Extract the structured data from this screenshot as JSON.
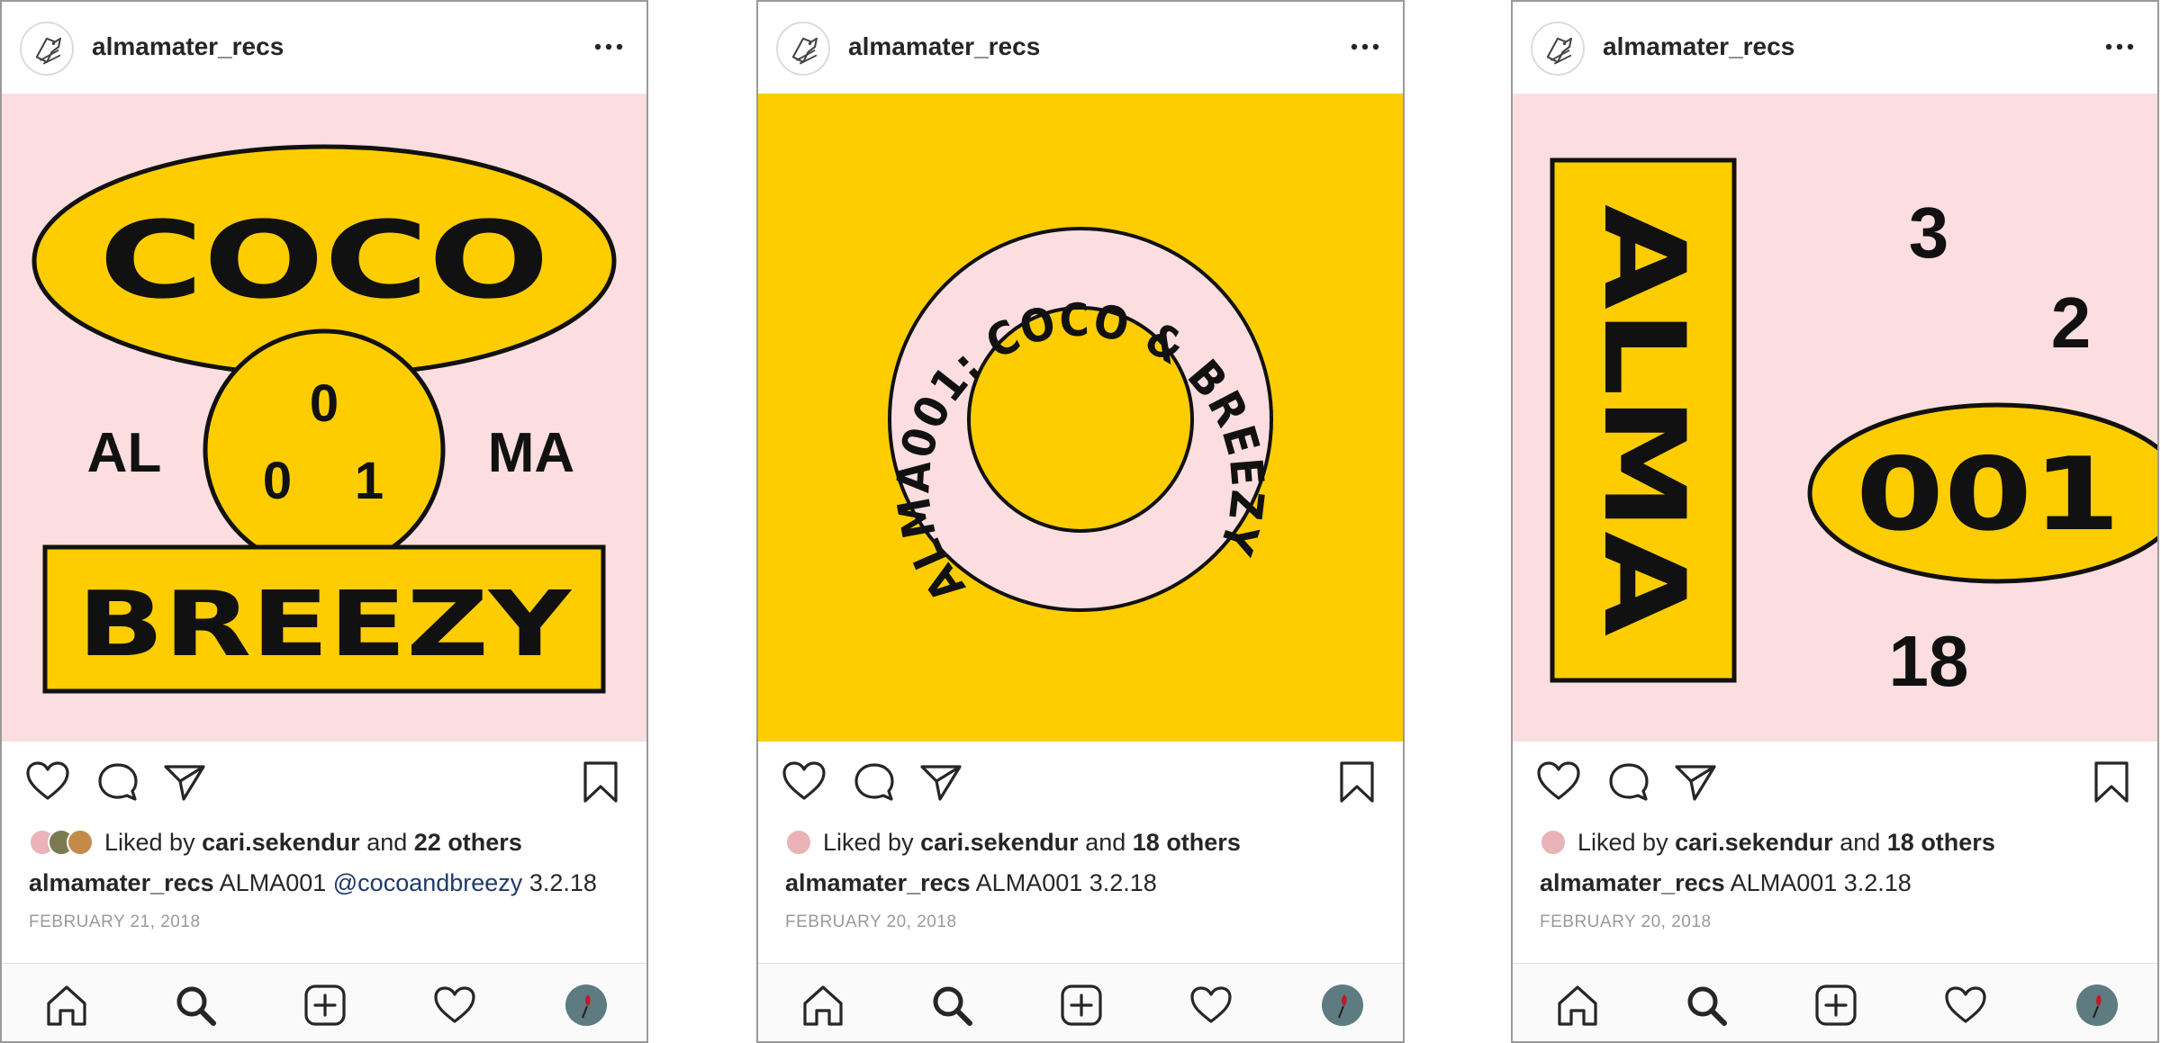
{
  "colors": {
    "pink": "#fcdde0",
    "yellow": "#fdcd00",
    "ink": "#111111",
    "link": "#1e3a6b",
    "meta": "#9a9a9a"
  },
  "icons": {
    "avatar": "bird-logo-avatar",
    "more": "ellipsis-icon",
    "like": "heart-outline-icon",
    "comment": "comment-bubble-icon",
    "share": "paper-plane-icon",
    "save": "bookmark-icon",
    "tabs": [
      "home-icon",
      "search-icon",
      "plus-square-icon",
      "heart-icon",
      "profile-avatar-icon"
    ]
  },
  "posts": [
    {
      "username": "almamater_recs",
      "liked_prefix": "Liked by",
      "liked_user": "cari.sekendur",
      "liked_and": "and",
      "liked_others": "22 others",
      "caption_user": "almamater_recs",
      "caption_text": "ALMA001",
      "caption_mention": "@cocoandbreezy",
      "caption_tail": "3.2.18",
      "date": "FEBRUARY 21, 2018",
      "artwork": {
        "top": "COCO",
        "left": "AL",
        "right": "MA",
        "n1": "0",
        "n2": "0",
        "n3": "1",
        "bottom": "BREEZY"
      }
    },
    {
      "username": "almamater_recs",
      "liked_prefix": "Liked by",
      "liked_user": "cari.sekendur",
      "liked_and": "and",
      "liked_others": "18 others",
      "caption_user": "almamater_recs",
      "caption_text": "ALMA001 3.2.18",
      "date": "FEBRUARY 20, 2018",
      "artwork": {
        "ring_text": "ALMA001: COCO & BREEZY"
      }
    },
    {
      "username": "almamater_recs",
      "liked_prefix": "Liked by",
      "liked_user": "cari.sekendur",
      "liked_and": "and",
      "liked_others": "18 others",
      "caption_user": "almamater_recs",
      "caption_text": "ALMA001 3.2.18",
      "date": "FEBRUARY 20, 2018",
      "artwork": {
        "vertical": "ALMA",
        "oval": "001",
        "d1": "3",
        "d2": "2",
        "d3": "18"
      }
    }
  ]
}
